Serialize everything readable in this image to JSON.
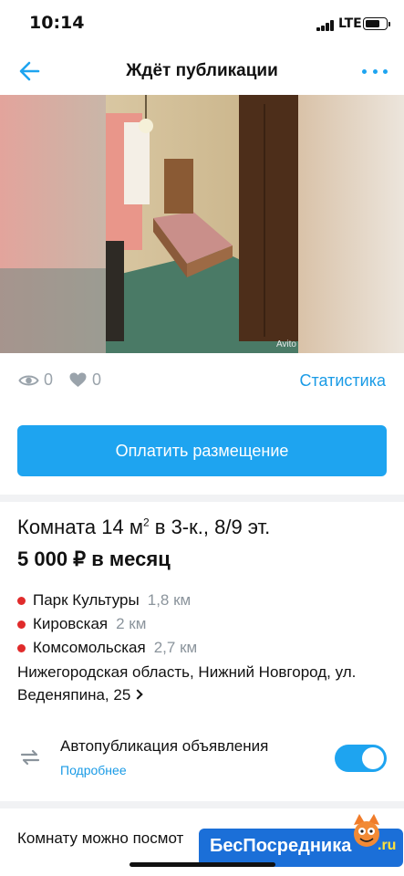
{
  "status_bar": {
    "time": "10:14",
    "network": "LTE"
  },
  "nav": {
    "title": "Ждёт публикации",
    "back_icon": "arrow-left-icon",
    "more_icon": "more-dots-icon"
  },
  "photo": {
    "watermark": "Avito"
  },
  "stats": {
    "views": "0",
    "likes": "0",
    "stats_link": "Статистика"
  },
  "pay_button": "Оплатить размещение",
  "listing": {
    "title_main": "Комната 14 м",
    "title_sup": "2",
    "title_rest": " в 3-к., 8/9 эт.",
    "price": "5 000 ₽ в месяц",
    "metro": [
      {
        "name": "Парк Культуры",
        "distance": "1,8 км"
      },
      {
        "name": "Кировская",
        "distance": "2 км"
      },
      {
        "name": "Комсомольская",
        "distance": "2,7 км"
      }
    ],
    "address": "Нижегородская область, Нижний Новгород, ул. Веденяпина, 25"
  },
  "autopublish": {
    "label": "Автопубликация объявления",
    "link": "Подробнее",
    "enabled": true
  },
  "note": "Комнату можно посмот",
  "watermark": {
    "text": "БесПосредника",
    "suffix": ".ru"
  },
  "colors": {
    "accent": "#1ea4f0",
    "link": "#1a9be6",
    "metro": "#e02b2b",
    "muted": "#8b949c"
  }
}
